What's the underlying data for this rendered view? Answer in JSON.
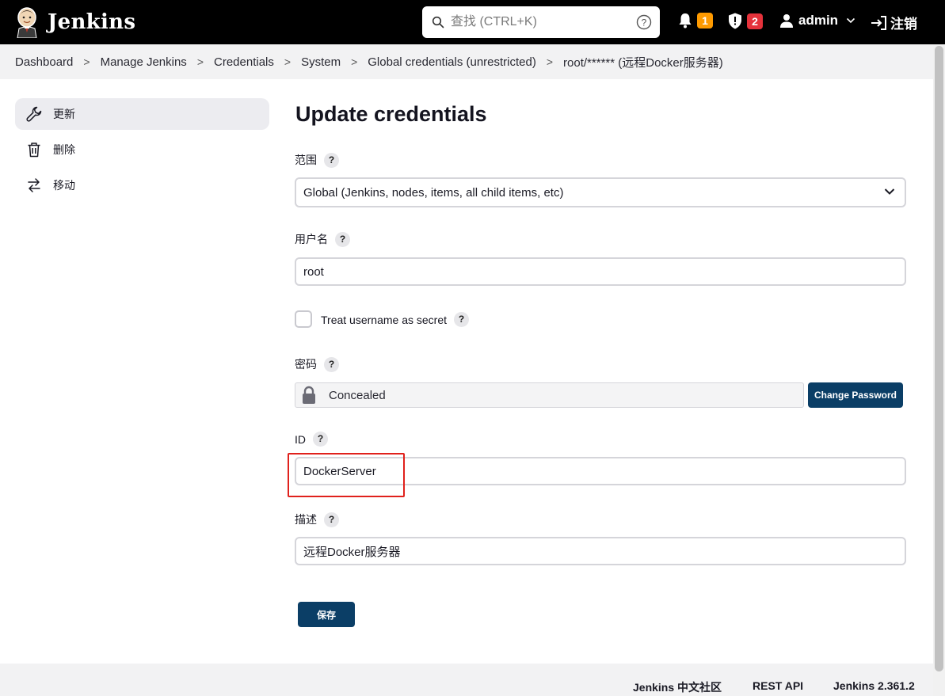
{
  "header": {
    "app_name": "Jenkins",
    "search_placeholder": "查找 (CTRL+K)",
    "notifications_count": "1",
    "security_count": "2",
    "user_name": "admin",
    "logout_label": "注销"
  },
  "breadcrumb": [
    "Dashboard",
    "Manage Jenkins",
    "Credentials",
    "System",
    "Global credentials (unrestricted)",
    "root/****** (远程Docker服务器)"
  ],
  "sidebar": {
    "items": [
      {
        "label": "更新",
        "icon": "wrench-icon",
        "active": true
      },
      {
        "label": "删除",
        "icon": "trash-icon",
        "active": false
      },
      {
        "label": "移动",
        "icon": "swap-icon",
        "active": false
      }
    ]
  },
  "form": {
    "title": "Update credentials",
    "scope_label": "范围",
    "scope_value": "Global (Jenkins, nodes, items, all child items, etc)",
    "username_label": "用户名",
    "username_value": "root",
    "secret_checkbox_label": "Treat username as secret",
    "secret_checked": false,
    "password_label": "密码",
    "password_state": "Concealed",
    "change_password_label": "Change Password",
    "id_label": "ID",
    "id_value": "DockerServer",
    "description_label": "描述",
    "description_value": "远程Docker服务器",
    "save_label": "保存",
    "help_mark": "?"
  },
  "footer": {
    "links": [
      "Jenkins 中文社区",
      "REST API",
      "Jenkins 2.361.2"
    ]
  },
  "colors": {
    "header_bg": "#000000",
    "primary_button": "#0b3e66",
    "highlight": "#e0211c",
    "badge_warning": "#fe9a00",
    "badge_danger": "#e5323b"
  }
}
